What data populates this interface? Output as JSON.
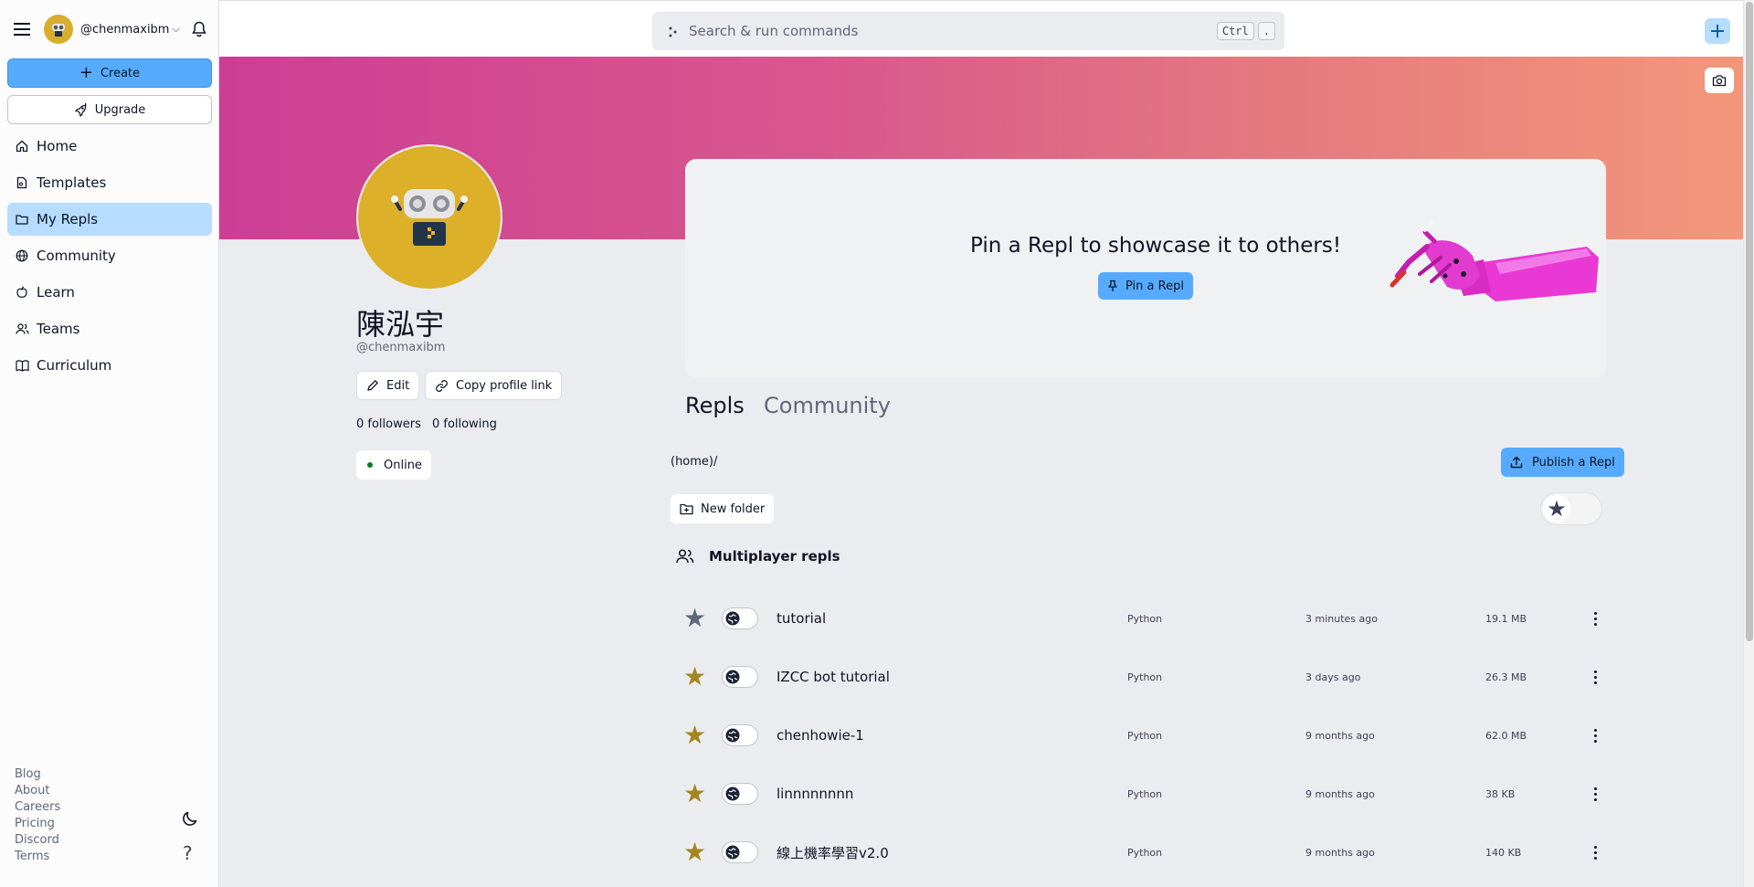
{
  "sidebar": {
    "username": "@chenmaxibm",
    "create_label": "Create",
    "upgrade_label": "Upgrade",
    "nav": [
      {
        "label": "Home",
        "icon": "home-icon"
      },
      {
        "label": "Templates",
        "icon": "templates-icon"
      },
      {
        "label": "My Repls",
        "icon": "folder-icon",
        "active": true
      },
      {
        "label": "Community",
        "icon": "globe-icon"
      },
      {
        "label": "Learn",
        "icon": "learn-icon"
      },
      {
        "label": "Teams",
        "icon": "teams-icon"
      },
      {
        "label": "Curriculum",
        "icon": "book-icon"
      }
    ],
    "footer": [
      "Blog",
      "About",
      "Careers",
      "Pricing",
      "Discord",
      "Terms"
    ],
    "help_label": "?"
  },
  "topbar": {
    "search_placeholder": "Search & run commands",
    "shortcut_keys": [
      "Ctrl",
      "."
    ]
  },
  "profile": {
    "name": "陳泓宇",
    "handle": "@chenmaxibm",
    "edit_label": "Edit",
    "copy_link_label": "Copy profile link",
    "followers": "0 followers",
    "following": "0 following",
    "status": "Online"
  },
  "pin": {
    "title": "Pin a Repl to showcase it to others!",
    "button_label": "Pin a Repl"
  },
  "tabs": [
    "Repls",
    "Community"
  ],
  "repls": {
    "path": "(home)/",
    "publish_label": "Publish a Repl",
    "new_folder_label": "New folder",
    "section_title": "Multiplayer repls",
    "rows": [
      {
        "name": "tutorial",
        "language": "Python",
        "updated": "3 minutes ago",
        "size": "19.1 MB",
        "starred": false
      },
      {
        "name": "IZCC bot tutorial",
        "language": "Python",
        "updated": "3 days ago",
        "size": "26.3 MB",
        "starred": true
      },
      {
        "name": "chenhowie-1",
        "language": "Python",
        "updated": "9 months ago",
        "size": "62.0 MB",
        "starred": true
      },
      {
        "name": "linnnnnnnn",
        "language": "Python",
        "updated": "9 months ago",
        "size": "38 KB",
        "starred": true
      },
      {
        "name": "線上機率學習v2.0",
        "language": "Python",
        "updated": "9 months ago",
        "size": "140 KB",
        "starred": true
      }
    ]
  },
  "colors": {
    "accent": "#57abff",
    "active_nav": "#b6dcff",
    "star_on": "#a2861f",
    "banner_start": "#cc3e94",
    "banner_end": "#f2977a",
    "avatar": "#ddb02a"
  }
}
